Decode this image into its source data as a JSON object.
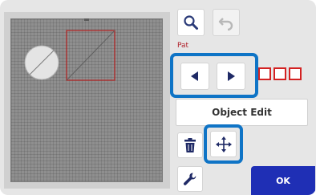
{
  "mat": {
    "background_color": "#8f8f8f",
    "pattern_color": "#e4e4e4",
    "outline_color": "#b52323"
  },
  "toolbar": {
    "zoom_icon": "magnifier-icon",
    "undo_icon": "undo-icon",
    "undo_enabled": false,
    "prev_icon": "triangle-left-icon",
    "next_icon": "triangle-right-icon",
    "delete_icon": "trash-icon",
    "move_icon": "four-way-arrow-icon",
    "settings_icon": "wrench-icon"
  },
  "object_edit_label": "Object Edit",
  "ok_label": "OK",
  "partial_label": "Pat",
  "arrangement_icons": [
    "square-outline-icon",
    "square-outline-icon",
    "square-outline-icon"
  ],
  "colors": {
    "highlight": "#0f74c6",
    "ok_button": "#1f2fb5",
    "accent_red": "#d32222"
  }
}
